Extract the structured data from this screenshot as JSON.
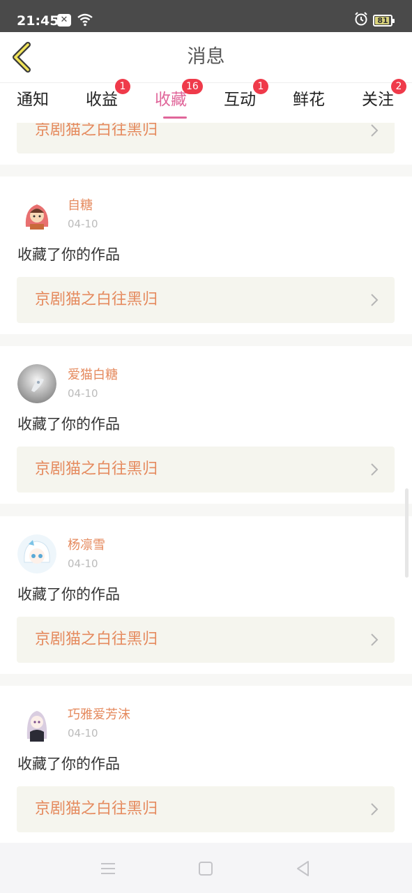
{
  "status_bar": {
    "time": "21:45",
    "battery": "81"
  },
  "header": {
    "title": "消息"
  },
  "tabs": [
    {
      "label": "通知",
      "badge": ""
    },
    {
      "label": "收益",
      "badge": "1"
    },
    {
      "label": "收藏",
      "badge": "16"
    },
    {
      "label": "互动",
      "badge": "1"
    },
    {
      "label": "鲜花",
      "badge": ""
    },
    {
      "label": "关注",
      "badge": "2"
    }
  ],
  "active_tab": "收藏",
  "partial_card": {
    "work_title": "京剧猫之白往黑归"
  },
  "items": [
    {
      "user": "自糖",
      "date": "04-10",
      "action": "收藏了你的作品",
      "work_title": "京剧猫之白往黑归"
    },
    {
      "user": "爱猫白糖",
      "date": "04-10",
      "action": "收藏了你的作品",
      "work_title": "京剧猫之白往黑归"
    },
    {
      "user": "杨凛雪",
      "date": "04-10",
      "action": "收藏了你的作品",
      "work_title": "京剧猫之白往黑归"
    },
    {
      "user": "巧雅爱芳沫",
      "date": "04-10",
      "action": "收藏了你的作品",
      "work_title": "京剧猫之白往黑归"
    }
  ],
  "colors": {
    "accent": "#e0669a",
    "badge": "#ef3a4a",
    "link_text": "#e58a5e",
    "link_bg": "#f5f5ee"
  },
  "icons": [
    "back-arrow-icon",
    "chevron-right-icon",
    "menu-icon",
    "home-square-icon",
    "back-triangle-icon"
  ]
}
